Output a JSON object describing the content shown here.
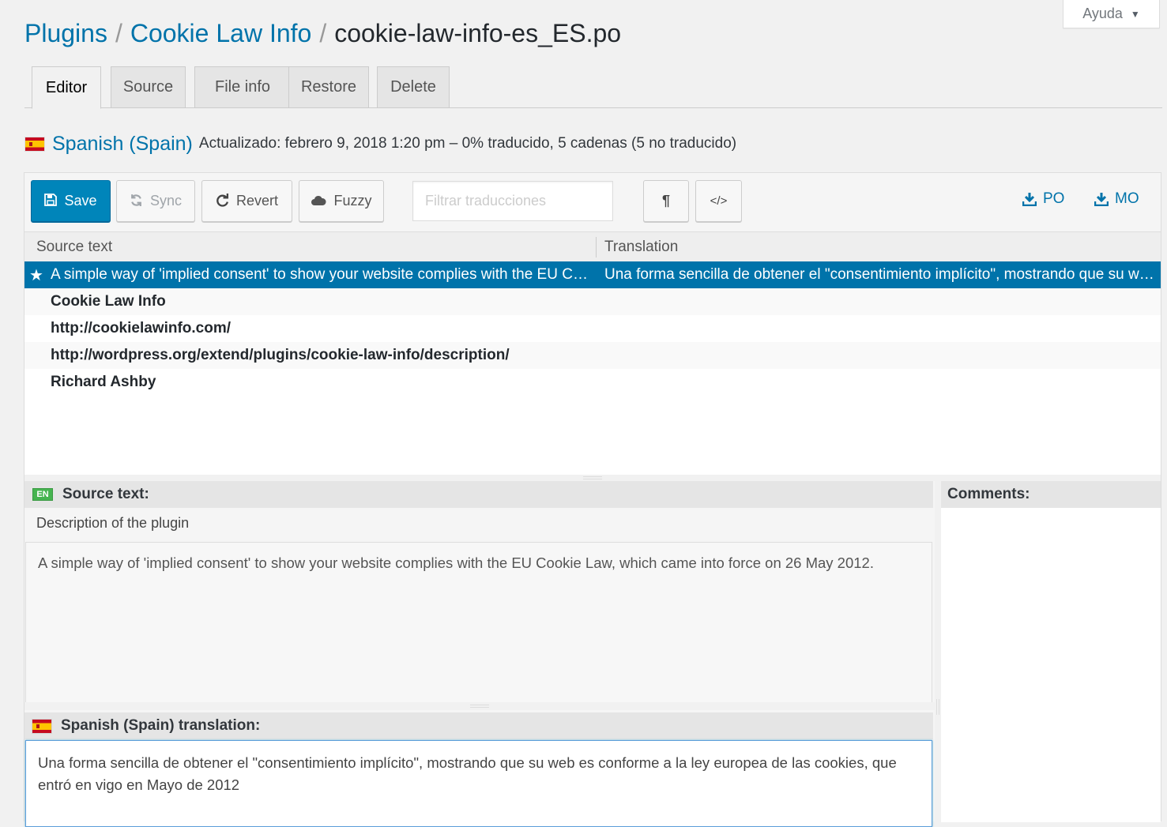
{
  "help": {
    "label": "Ayuda",
    "caret": "▼"
  },
  "breadcrumb": {
    "plugins": "Plugins",
    "plugin": "Cookie Law Info",
    "file": "cookie-law-info-es_ES.po",
    "sep": "/"
  },
  "tabs": [
    {
      "label": "Editor",
      "active": true
    },
    {
      "label": "Source"
    },
    {
      "label": "File info"
    },
    {
      "label": "Restore"
    },
    {
      "label": "Delete"
    }
  ],
  "locale": {
    "name": "Spanish (Spain)",
    "meta": "Actualizado: febrero 9, 2018 1:20 pm – 0% traducido, 5 cadenas (5 no traducido)"
  },
  "toolbar": {
    "save": "Save",
    "sync": "Sync",
    "revert": "Revert",
    "fuzzy": "Fuzzy",
    "filter_placeholder": "Filtrar traducciones",
    "pilcrow": "¶",
    "code": "</>",
    "po": "PO",
    "mo": "MO"
  },
  "grid": {
    "col_source": "Source text",
    "col_translation": "Translation",
    "rows": [
      {
        "source": "A simple way of 'implied consent' to show your website complies with the EU Cookie Law, which came into force on 26 May 2012.",
        "translation": "Una forma sencilla de obtener el \"consentimiento implícito\", mostrando que su web es conforme a la ley europea de las cookies, que entró en vigo en Mayo de 2012"
      },
      {
        "source": "Cookie Law Info",
        "translation": ""
      },
      {
        "source": "http://cookielawinfo.com/",
        "translation": ""
      },
      {
        "source": "http://wordpress.org/extend/plugins/cookie-law-info/description/",
        "translation": ""
      },
      {
        "source": "Richard Ashby",
        "translation": ""
      }
    ]
  },
  "source_panel": {
    "badge": "EN",
    "title": "Source text:",
    "context": "Description of the plugin",
    "text": "A simple way of 'implied consent' to show your website complies with the EU Cookie Law, which came into force on 26 May 2012."
  },
  "translation_panel": {
    "title": "Spanish (Spain) translation:",
    "text": "Una forma sencilla de obtener el \"consentimiento implícito\", mostrando que su web es conforme a la ley europea de las cookies, que entró en vigo en Mayo de 2012"
  },
  "comments_panel": {
    "title": "Comments:"
  },
  "colors": {
    "accent": "#0073aa",
    "primary_button": "#0085ba",
    "badge_en": "#46b450"
  }
}
